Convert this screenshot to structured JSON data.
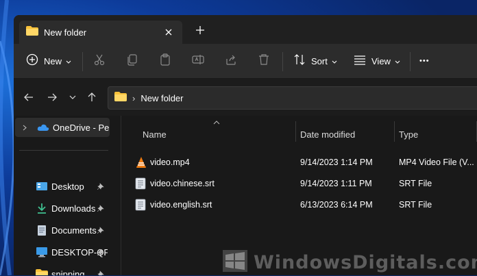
{
  "window": {
    "tab_title": "New folder",
    "close_glyph": "✕",
    "new_tab_glyph": "+"
  },
  "toolbar": {
    "new_label": "New",
    "sort_label": "Sort",
    "view_label": "View",
    "more_glyph": "•••",
    "icons": [
      "plus-circle-icon",
      "cut-icon",
      "copy-icon",
      "paste-icon",
      "rename-icon",
      "share-icon",
      "delete-icon",
      "sort-icon",
      "view-icon",
      "more-icon"
    ]
  },
  "navigation": {
    "back_glyph": "←",
    "forward_glyph": "→",
    "recent_glyph": "⌄",
    "up_glyph": "↑",
    "breadcrumb_sep": "›",
    "breadcrumb": "New folder"
  },
  "sidebar": {
    "items": [
      {
        "label": "OneDrive - Pers",
        "icon": "onedrive-icon",
        "selected": true
      },
      {
        "label": "Desktop",
        "icon": "desktop-icon",
        "pinned": true
      },
      {
        "label": "Downloads",
        "icon": "download-icon",
        "pinned": true
      },
      {
        "label": "Documents",
        "icon": "documents-icon",
        "pinned": true
      },
      {
        "label": "DESKTOP-QF",
        "icon": "computer-icon",
        "pinned": true
      },
      {
        "label": "snipping",
        "icon": "folder-icon",
        "pinned": true
      }
    ]
  },
  "filelist": {
    "columns": {
      "name": "Name",
      "date": "Date modified",
      "type": "Type"
    },
    "rows": [
      {
        "name": "video.mp4",
        "date": "9/14/2023 1:14 PM",
        "type": "MP4 Video File (V...",
        "icon": "vlc-icon"
      },
      {
        "name": "video.chinese.srt",
        "date": "9/14/2023 1:11 PM",
        "type": "SRT File",
        "icon": "text-file-icon"
      },
      {
        "name": "video.english.srt",
        "date": "6/13/2023 6:14 PM",
        "type": "SRT File",
        "icon": "text-file-icon"
      }
    ]
  },
  "watermark": {
    "text": "WindowsDigitals.com"
  },
  "colors": {
    "accent": "#60cdff",
    "folder": "#f8c13a",
    "window_bg": "#191919",
    "toolbar_bg": "#2c2c2c"
  }
}
